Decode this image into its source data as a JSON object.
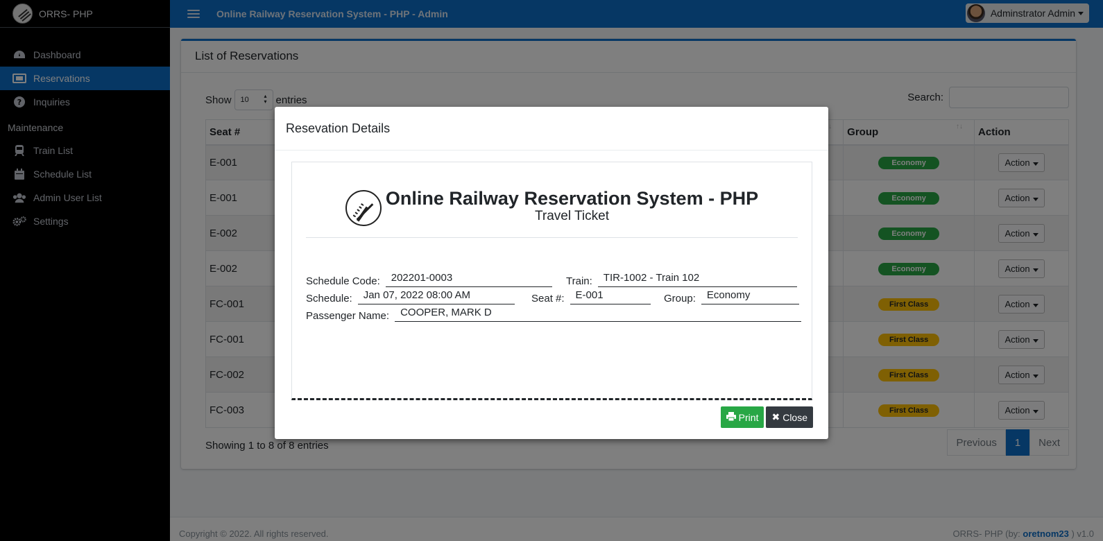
{
  "brand": {
    "name": "ORRS- PHP"
  },
  "navbar": {
    "title": "Online Railway Reservation System - PHP - Admin",
    "user": "Adminstrator Admin"
  },
  "sidebar": {
    "items": [
      {
        "label": "Dashboard",
        "icon": "dashboard-icon"
      },
      {
        "label": "Reservations",
        "icon": "ticket-icon",
        "active": true
      },
      {
        "label": "Inquiries",
        "icon": "question-icon"
      }
    ],
    "maintenance_header": "Maintenance",
    "maintenance": [
      {
        "label": "Train List",
        "icon": "train-icon"
      },
      {
        "label": "Schedule List",
        "icon": "calendar-icon"
      },
      {
        "label": "Admin User List",
        "icon": "users-icon"
      },
      {
        "label": "Settings",
        "icon": "gear-icon"
      }
    ]
  },
  "card": {
    "title": "List of Reservations",
    "show_label": "Show",
    "entries_label": "entries",
    "length_value": "10",
    "search_label": "Search:",
    "columns": [
      "Seat #",
      "Group",
      "Action"
    ],
    "rows": [
      {
        "seat": "E-001",
        "group": "Economy",
        "action": "Action"
      },
      {
        "seat": "E-001",
        "group": "Economy",
        "action": "Action"
      },
      {
        "seat": "E-002",
        "group": "Economy",
        "action": "Action"
      },
      {
        "seat": "E-002",
        "group": "Economy",
        "action": "Action"
      },
      {
        "seat": "FC-001",
        "group": "First Class",
        "action": "Action"
      },
      {
        "seat": "FC-001",
        "group": "First Class",
        "action": "Action"
      },
      {
        "seat": "FC-002",
        "group": "First Class",
        "action": "Action"
      },
      {
        "seat": "FC-003",
        "group": "First Class",
        "action": "Action"
      }
    ],
    "info": "Showing 1 to 8 of 8 entries",
    "pager": {
      "prev": "Previous",
      "current": "1",
      "next": "Next"
    }
  },
  "footer": {
    "copyright": "Copyright © 2022. All rights reserved.",
    "credit_prefix": "ORRS- PHP (by: ",
    "credit_author": "oretnom23",
    "credit_suffix": " ) v1.0"
  },
  "modal": {
    "title": "Resevation Details",
    "ticket": {
      "system_name": "Online Railway Reservation System - PHP",
      "subtitle": "Travel Ticket",
      "schedule_code_label": "Schedule Code:",
      "schedule_code": "202201-0003",
      "train_label": "Train:",
      "train": "TIR-1002 - Train 102",
      "schedule_label": "Schedule:",
      "schedule": "Jan 07, 2022 08:00 AM",
      "seat_label": "Seat #:",
      "seat": "E-001",
      "group_label": "Group:",
      "group": "Economy",
      "passenger_label": "Passenger Name:",
      "passenger": "COOPER, MARK D"
    },
    "print_label": "Print",
    "close_label": "Close"
  },
  "colors": {
    "primary": "#0d6ec9",
    "economy": "#28a745",
    "first_class": "#ffc107",
    "sidebar": "#000000"
  }
}
